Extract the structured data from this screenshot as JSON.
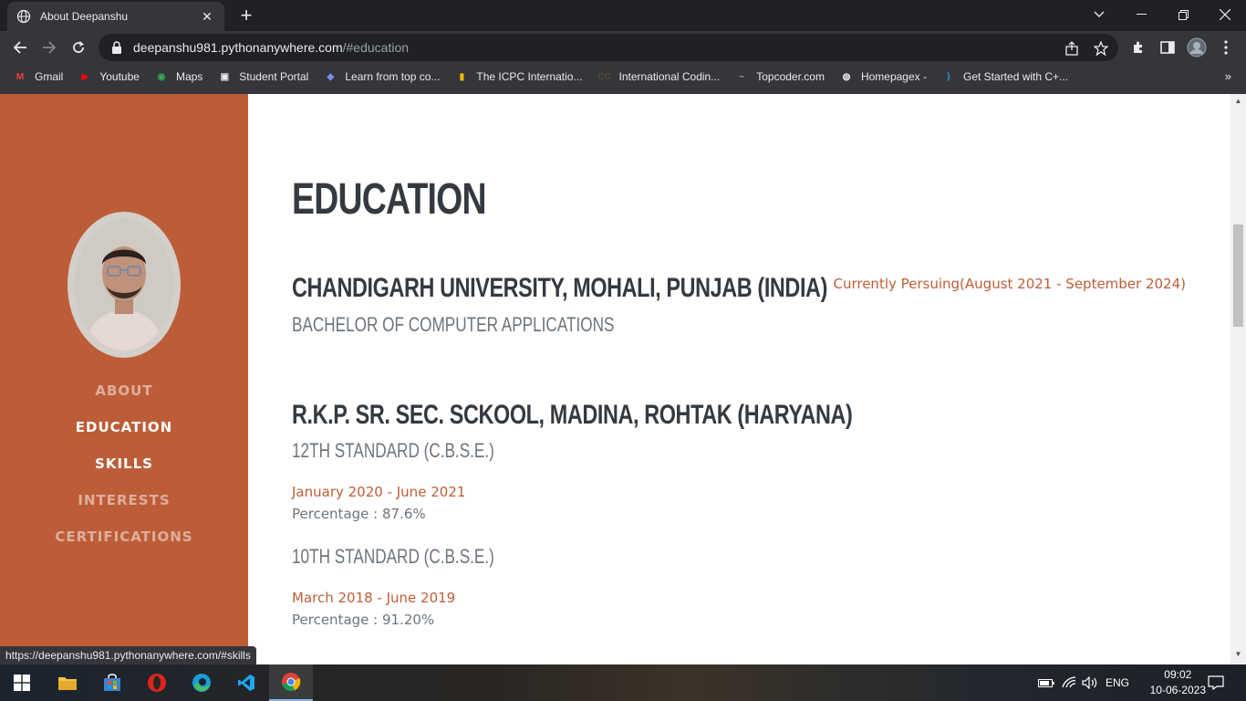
{
  "browser": {
    "tab_title": "About Deepanshu",
    "tab_close": "✕",
    "new_tab": "+",
    "url_host": "deepanshu981.pythonanywhere.com",
    "url_path": "/#education",
    "status_url": "https://deepanshu981.pythonanywhere.com/#skills"
  },
  "bookmarks": [
    {
      "label": "Gmail",
      "icon": "gmail-icon",
      "color": "#ea4335",
      "glyph": "M"
    },
    {
      "label": "Youtube",
      "icon": "youtube-icon",
      "color": "#ff0000",
      "glyph": "▶"
    },
    {
      "label": "Maps",
      "icon": "maps-icon",
      "color": "#34a853",
      "glyph": "◉"
    },
    {
      "label": "Student Portal",
      "icon": "student-portal-icon",
      "color": "#e8eaed",
      "glyph": "▣"
    },
    {
      "label": "Learn from top co...",
      "icon": "learn-icon",
      "color": "#7c8cf8",
      "glyph": "◆"
    },
    {
      "label": "The ICPC Internatio...",
      "icon": "icpc-icon",
      "color": "#f4b400",
      "glyph": "▮"
    },
    {
      "label": "International Codin...",
      "icon": "cc-icon",
      "color": "#5b4636",
      "glyph": "CC"
    },
    {
      "label": "Topcoder.com",
      "icon": "topcoder-icon",
      "color": "#9aa0a6",
      "glyph": "~"
    },
    {
      "label": "Homepagex -",
      "icon": "globe-icon",
      "color": "#e8eaed",
      "glyph": "◍"
    },
    {
      "label": "Get Started with C+...",
      "icon": "vscode-icon",
      "color": "#22a6f2",
      "glyph": "⟩"
    }
  ],
  "sidebar": {
    "nav": [
      {
        "label": "ABOUT",
        "active": false
      },
      {
        "label": "EDUCATION",
        "active": true
      },
      {
        "label": "SKILLS",
        "active": false
      },
      {
        "label": "INTERESTS",
        "active": false
      },
      {
        "label": "CERTIFICATIONS",
        "active": false
      }
    ]
  },
  "education": {
    "heading": "EDUCATION",
    "entries": [
      {
        "institution": "CHANDIGARH UNIVERSITY, MOHALI, PUNJAB (INDIA)",
        "degree": "BACHELOR OF COMPUTER APPLICATIONS",
        "date": "Currently Persuing(August 2021 - September 2024)"
      },
      {
        "institution": "R.K.P. SR. SEC. SCKOOL, MADINA, ROHTAK (HARYANA)",
        "levels": [
          {
            "standard": "12TH STANDARD (C.B.S.E.)",
            "date": "January 2020 - June 2021",
            "percentage": "Percentage : 87.6%"
          },
          {
            "standard": "10TH STANDARD (C.B.S.E.)",
            "date": "March 2018 - June 2019",
            "percentage": "Percentage : 91.20%"
          }
        ]
      }
    ]
  },
  "taskbar": {
    "language": "ENG",
    "time": "09:02",
    "date": "10-06-2023"
  },
  "colors": {
    "accent": "#bd5d38",
    "heading": "#343a40",
    "muted": "#6c757d"
  }
}
